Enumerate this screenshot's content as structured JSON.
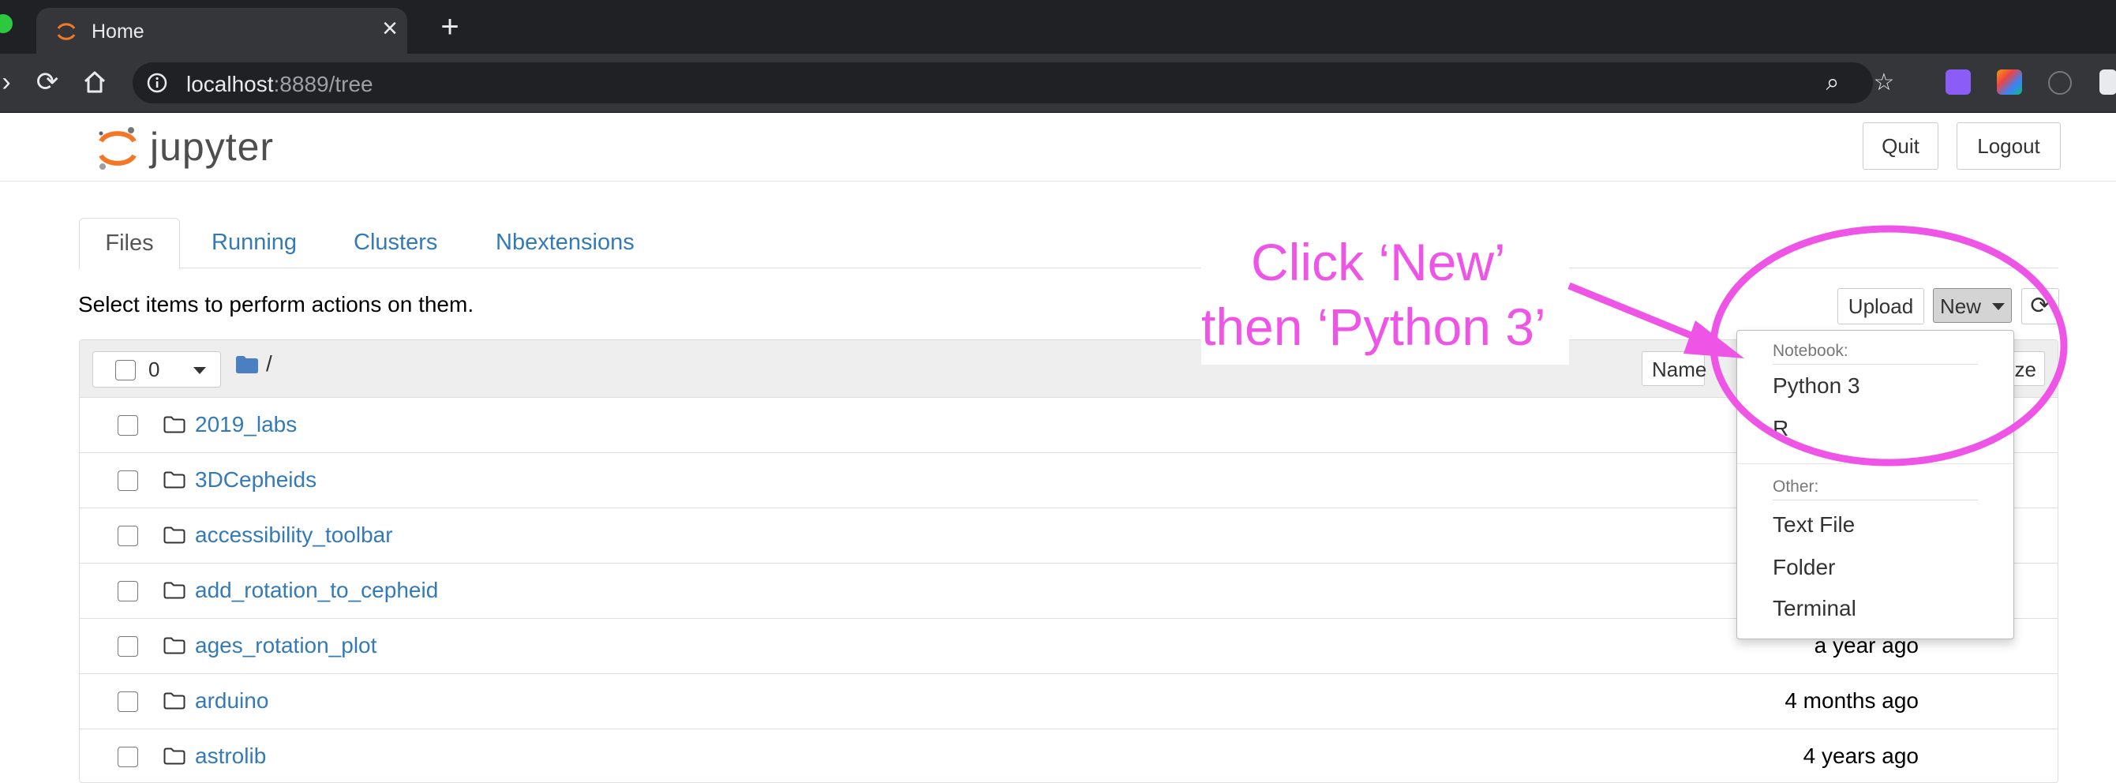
{
  "browser": {
    "tab_title": "Home",
    "url_host": "localhost",
    "url_rest": ":8889/tree"
  },
  "header": {
    "logo_text": "jupyter",
    "quit_label": "Quit",
    "logout_label": "Logout"
  },
  "tabs": [
    "Files",
    "Running",
    "Clusters",
    "Nbextensions"
  ],
  "toolbar": {
    "hint": "Select items to perform actions on them.",
    "upload_label": "Upload",
    "new_label": "New"
  },
  "list_header": {
    "selected_count": "0",
    "path": "/",
    "name_label": "Name",
    "size_label": "ze"
  },
  "files": [
    {
      "name": "2019_labs",
      "modified": ""
    },
    {
      "name": "3DCepheids",
      "modified": ""
    },
    {
      "name": "accessibility_toolbar",
      "modified": ""
    },
    {
      "name": "add_rotation_to_cepheid",
      "modified": ""
    },
    {
      "name": "ages_rotation_plot",
      "modified": "a year ago"
    },
    {
      "name": "arduino",
      "modified": "4 months ago"
    },
    {
      "name": "astrolib",
      "modified": "4 years ago"
    }
  ],
  "new_menu": {
    "notebook_header": "Notebook:",
    "notebook_items": [
      "Python 3",
      "R"
    ],
    "other_header": "Other:",
    "other_items": [
      "Text File",
      "Folder",
      "Terminal"
    ]
  },
  "annotation": {
    "line1": "Click ‘New’",
    "line2": "then ‘Python 3’",
    "color": "#ee55e6"
  }
}
